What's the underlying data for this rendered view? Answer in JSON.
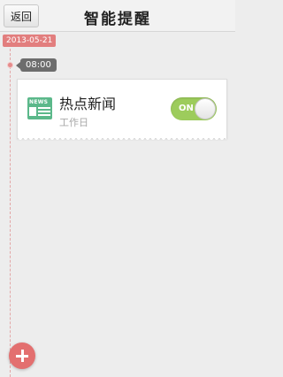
{
  "header": {
    "back_label": "返回",
    "title": "智能提醒"
  },
  "timeline": {
    "date": "2013-05-21",
    "time": "08:00"
  },
  "reminder": {
    "icon_text": "NEWS",
    "title": "热点新闻",
    "subtitle": "工作日",
    "toggle_label": "ON",
    "toggle_state": "on"
  },
  "colors": {
    "accent_red": "#e27e7e",
    "toggle_green": "#9dcc5c",
    "icon_green": "#5bb88a"
  },
  "icons": {
    "news": "news-icon",
    "add": "plus-icon"
  }
}
